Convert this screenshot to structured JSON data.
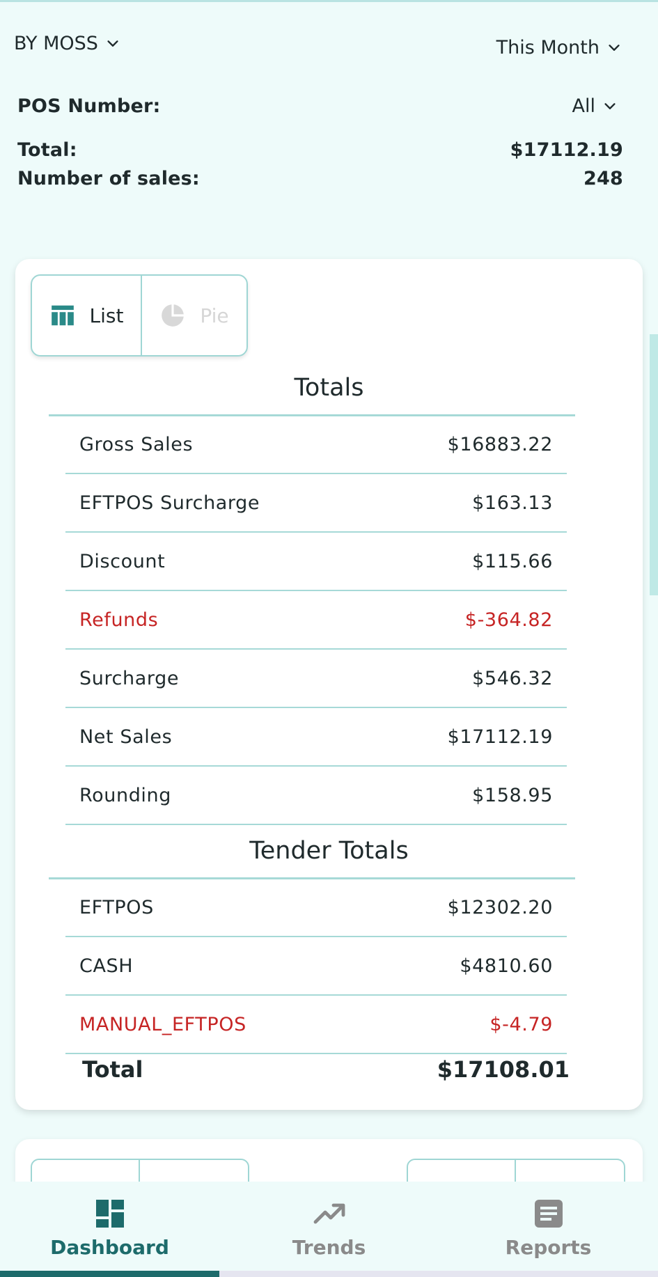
{
  "header": {
    "store": "BY MOSS",
    "period": "This Month",
    "pos_label": "POS Number:",
    "pos_value": "All",
    "total_label": "Total:",
    "total_value": "$17112.19",
    "sales_label": "Number of sales:",
    "sales_value": "248"
  },
  "view_toggle": {
    "list": "List",
    "pie": "Pie",
    "selected": "List"
  },
  "totals": {
    "title": "Totals",
    "rows": [
      {
        "label": "Gross Sales",
        "value": "$16883.22",
        "negative": false
      },
      {
        "label": "EFTPOS Surcharge",
        "value": "$163.13",
        "negative": false
      },
      {
        "label": "Discount",
        "value": "$115.66",
        "negative": false
      },
      {
        "label": "Refunds",
        "value": "$-364.82",
        "negative": true
      },
      {
        "label": "Surcharge",
        "value": "$546.32",
        "negative": false
      },
      {
        "label": "Net Sales",
        "value": "$17112.19",
        "negative": false
      },
      {
        "label": "Rounding",
        "value": "$158.95",
        "negative": false
      }
    ]
  },
  "tender_totals": {
    "title": "Tender Totals",
    "rows": [
      {
        "label": "EFTPOS",
        "value": "$12302.20",
        "negative": false
      },
      {
        "label": "CASH",
        "value": "$4810.60",
        "negative": false
      },
      {
        "label": "MANUAL_EFTPOS",
        "value": "$-4.79",
        "negative": true
      }
    ],
    "total_label": "Total",
    "total_value": "$17108.01"
  },
  "nav": {
    "items": [
      {
        "label": "Dashboard",
        "icon": "dashboard-icon",
        "active": true
      },
      {
        "label": "Trends",
        "icon": "trends-icon",
        "active": false
      },
      {
        "label": "Reports",
        "icon": "reports-icon",
        "active": false
      }
    ]
  },
  "colors": {
    "accent": "#1d6b6b",
    "divider": "#a6d9d7",
    "negative": "#c62424",
    "background": "#eefbfa"
  }
}
